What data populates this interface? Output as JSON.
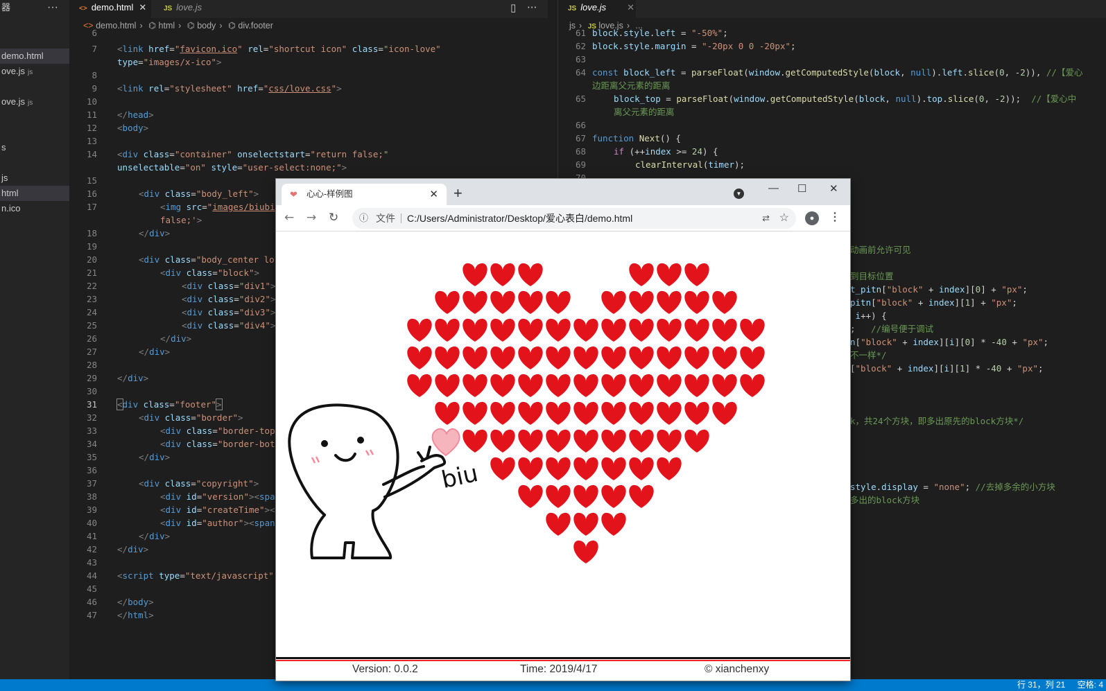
{
  "sidebar": {
    "header": "器",
    "section": "",
    "items": [
      {
        "label": "demo.html",
        "ext": "",
        "selected": true
      },
      {
        "label": "ove.js",
        "ext": "js",
        "selected": false
      },
      {
        "label": "ove.js",
        "ext": "js",
        "selected": false
      },
      {
        "label": "s",
        "ext": "",
        "selected": false
      },
      {
        "label": "js",
        "ext": "",
        "selected": false
      },
      {
        "label": "html",
        "ext": "",
        "selected": true
      },
      {
        "label": "n.ico",
        "ext": "",
        "selected": false
      }
    ]
  },
  "left_editor": {
    "tabs": [
      {
        "icon": "<>",
        "label": "demo.html",
        "active": true,
        "close": "✕"
      },
      {
        "icon": "JS",
        "label": "love.js",
        "active": false,
        "close": ""
      }
    ],
    "breadcrumb": [
      "demo.html",
      "html",
      "body",
      "div.footer"
    ],
    "current_line": "31"
  },
  "right_editor": {
    "tabs": [
      {
        "icon": "JS",
        "label": "love.js",
        "active": true,
        "close": "✕"
      }
    ],
    "breadcrumb": [
      "js",
      "love.js",
      "..."
    ]
  },
  "browser": {
    "tab_title": "心心-样例图",
    "url_label": "文件",
    "url": "C:/Users/Administrator/Desktop/爱心表白/demo.html",
    "page": {
      "biu_text": "biu",
      "heart_rows": [
        "01110001110",
        "11111011111",
        "1111111111111",
        "1111111111111",
        "1111111111111",
        "11111111111",
        "111111111",
        "1111111",
        "11111",
        "111",
        "1"
      ],
      "footer": {
        "version": "Version: 0.0.2",
        "time": "Time: 2019/4/17",
        "author": "© xianchenxy"
      }
    }
  },
  "status": {
    "position": "行 31，列 21",
    "spaces": "空格: 4"
  },
  "colors": {
    "heart": "#e3131b",
    "statusbar": "#007acc",
    "editor_bg": "#1e1e1e"
  }
}
